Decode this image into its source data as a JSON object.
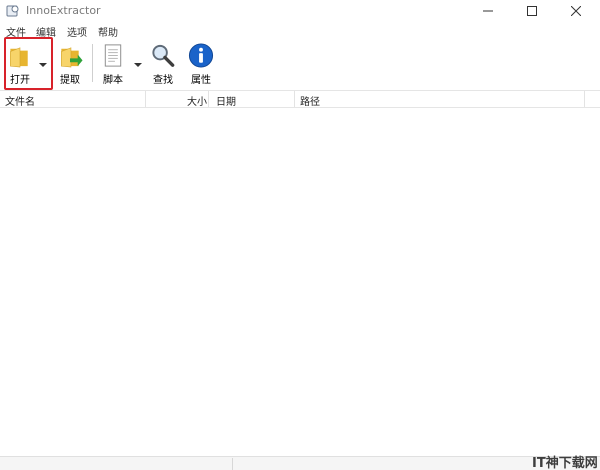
{
  "window": {
    "title": "InnoExtractor"
  },
  "menu": {
    "file": "文件",
    "edit": "编辑",
    "options": "选项",
    "help": "帮助"
  },
  "toolbar": {
    "open_label": "打开",
    "extract_label": "提取",
    "script_label": "脚本",
    "find_label": "查找",
    "properties_label": "属性"
  },
  "list": {
    "columns": [
      "文件名",
      "大小",
      "日期",
      "路径"
    ]
  },
  "watermark": {
    "text": "IT神下载网"
  },
  "colors": {
    "highlight": "#d8222a",
    "folder": "#f0c040",
    "info_blue": "#1a63c9",
    "extract_green": "#2fa23a"
  }
}
